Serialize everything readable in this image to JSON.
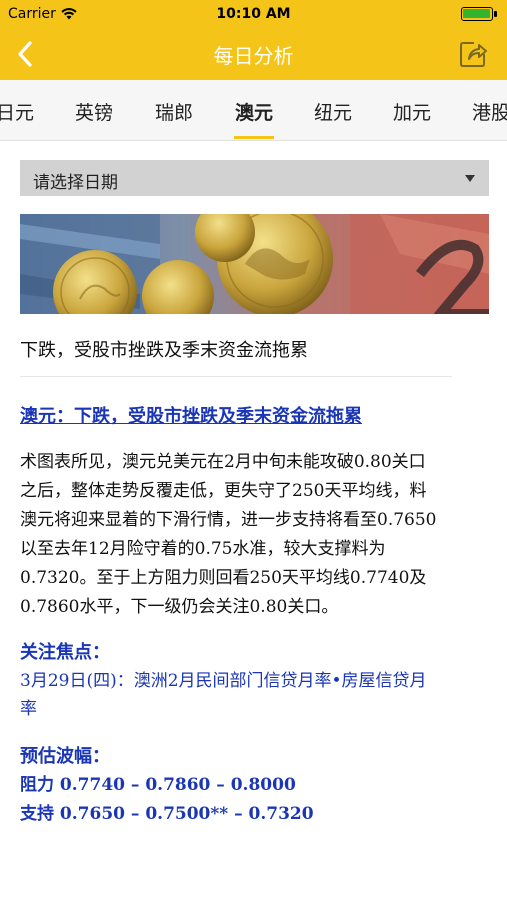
{
  "status_bar": {
    "carrier": "Carrier",
    "time": "10:10 AM"
  },
  "navbar": {
    "title": "每日分析"
  },
  "tabs": [
    {
      "label": "日元"
    },
    {
      "label": "英镑"
    },
    {
      "label": "瑞郎"
    },
    {
      "label": "澳元"
    },
    {
      "label": "纽元"
    },
    {
      "label": "加元"
    },
    {
      "label": "港股"
    }
  ],
  "active_tab": "澳元",
  "date_select": {
    "label": "请选择日期"
  },
  "headline": "下跌，受股市挫跌及季末资金流拖累",
  "article": {
    "title": "澳元：下跌，受股市挫跌及季末资金流拖累",
    "body_lines": [
      "术图表所见，澳元兑美元在2月中旬未能攻破0.80关口",
      "之后，整体走势反覆走低，更失守了250天平均线，料",
      "澳元将迎来显着的下滑行情，进一步支持将看至0.7650",
      "以至去年12月险守着的0.75水准，较大支撑料为",
      "0.7320。至于上方阻力则回看250天平均线0.7740及",
      "0.7860水平，下一级仍会关注0.80关口。"
    ],
    "focus_heading": "关注焦点：",
    "focus_lines": [
      "3月29日(四)：澳洲2月民间部门信贷月率•房屋信贷月",
      "率"
    ],
    "range_heading": "预估波幅：",
    "resistance": "阻力 0.7740 – 0.7860 – 0.8000",
    "support": "支持 0.7650 – 0.7500** – 0.7320"
  },
  "colors": {
    "accent": "#f4c518",
    "link_blue": "#1a36b5",
    "battery_green": "#33b32e"
  },
  "icons": [
    "wifi-icon",
    "battery-icon",
    "back-chevron-icon",
    "share-icon",
    "dropdown-arrow-icon"
  ]
}
